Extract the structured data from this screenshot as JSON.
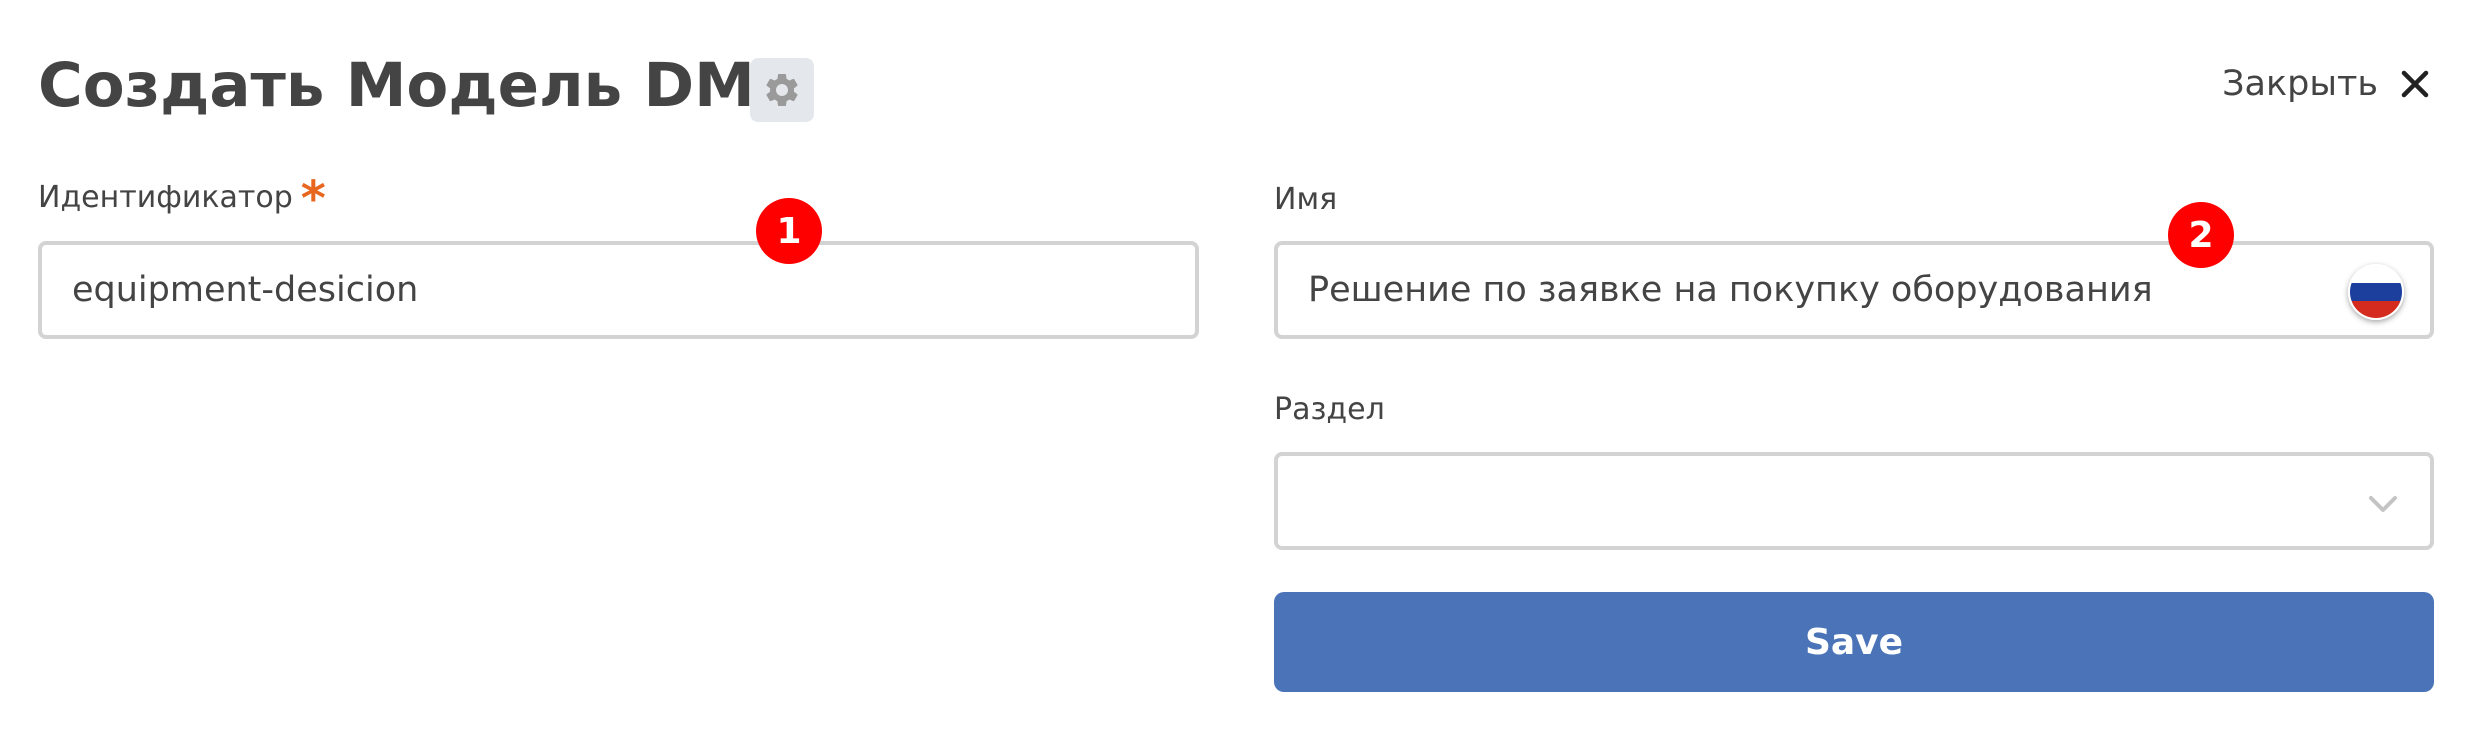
{
  "header": {
    "title": "Создать Модель DMN",
    "settings_icon": "gear-icon",
    "close_label": "Закрыть",
    "close_icon": "close-icon"
  },
  "form": {
    "identifier": {
      "label": "Идентификатор",
      "required_mark": "*",
      "value": "equipment-desicion",
      "badge": "1"
    },
    "name": {
      "label": "Имя",
      "value": "Решение по заявке на покупку оборудования",
      "badge": "2",
      "language_icon": "russian-flag-icon"
    },
    "section": {
      "label": "Раздел",
      "value": "",
      "dropdown_icon": "chevron-down-icon"
    },
    "save_label": "Save"
  },
  "colors": {
    "accent": "#4b74b8",
    "required": "#e8671e",
    "badge": "#ff0000",
    "text": "#444444",
    "border": "#d3d3d3"
  }
}
